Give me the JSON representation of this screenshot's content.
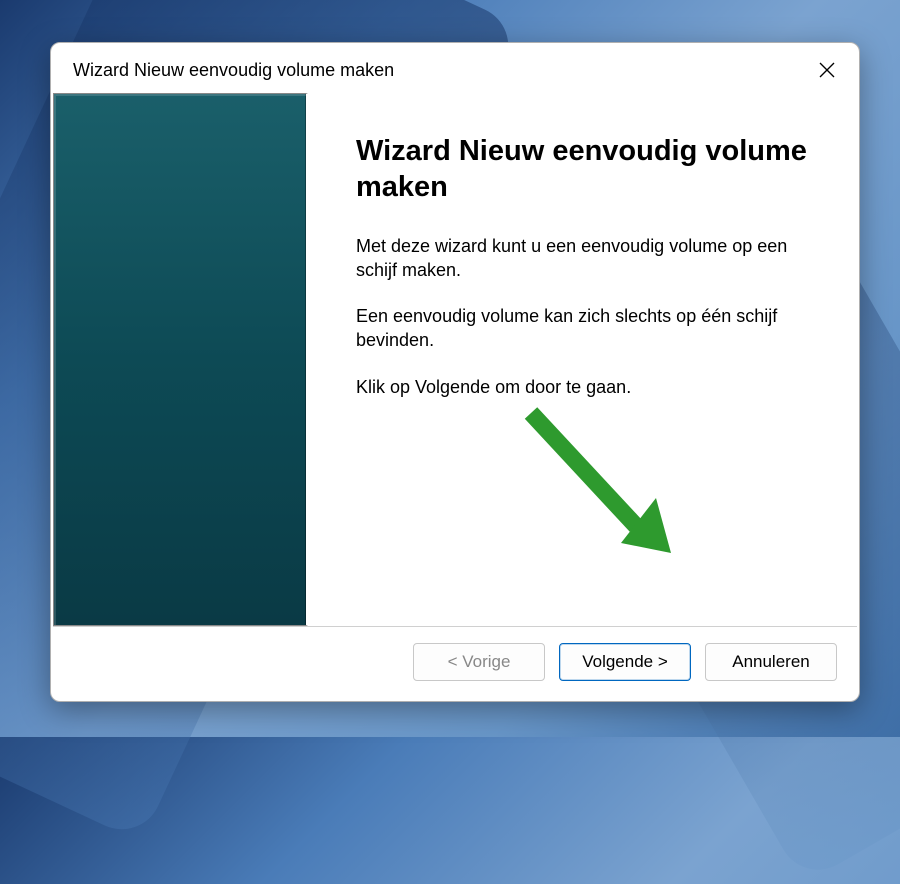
{
  "dialog": {
    "title": "Wizard Nieuw eenvoudig volume maken",
    "heading": "Wizard Nieuw eenvoudig volume maken",
    "paragraph1": "Met deze wizard kunt u een eenvoudig volume op een schijf maken.",
    "paragraph2": "Een eenvoudig volume kan zich slechts op één schijf bevinden.",
    "paragraph3": "Klik op Volgende om door te gaan.",
    "buttons": {
      "back": "< Vorige",
      "next": "Volgende >",
      "cancel": "Annuleren"
    }
  },
  "annotation": {
    "arrow_color": "#2e9a2e"
  }
}
